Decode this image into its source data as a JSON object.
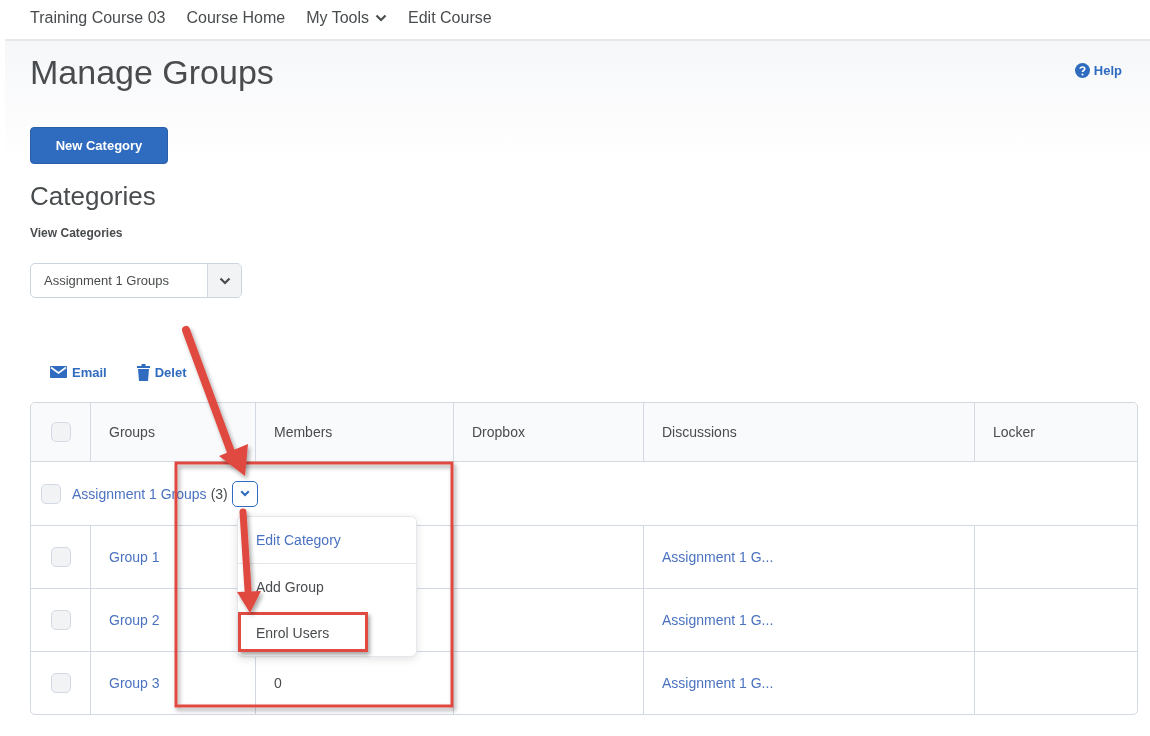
{
  "nav": {
    "items": [
      {
        "label": "Training Course 03",
        "has_menu": false
      },
      {
        "label": "Course Home",
        "has_menu": false
      },
      {
        "label": "My Tools",
        "has_menu": true
      },
      {
        "label": "Edit Course",
        "has_menu": false
      }
    ]
  },
  "page": {
    "title": "Manage Groups",
    "help": "Help"
  },
  "new_button": "New Category",
  "categories": {
    "heading": "Categories",
    "filter_label": "View Categories",
    "filter_value": "Assignment 1 Groups"
  },
  "toolbar": [
    {
      "kind": "email",
      "label": "Email"
    },
    {
      "kind": "delete",
      "label": "Delet"
    }
  ],
  "table": {
    "columns": [
      "Groups",
      "Members",
      "Dropbox",
      "Discussions",
      "Locker"
    ],
    "header_checked": false,
    "category": {
      "name": "Assignment 1 Groups",
      "count": "(3)",
      "checked": false,
      "menu_open": true
    },
    "rows": [
      {
        "name": "Group 1",
        "members": "",
        "discussion": "Assignment 1 G...",
        "checked": false
      },
      {
        "name": "Group 2",
        "members": "",
        "discussion": "Assignment 1 G...",
        "checked": false
      },
      {
        "name": "Group 3",
        "members": "0",
        "discussion": "Assignment 1 G...",
        "checked": false
      }
    ]
  },
  "menu": [
    {
      "label": "Edit Category",
      "kind": "link",
      "highlighted": false
    },
    {
      "label": "Add Group",
      "kind": "plain",
      "highlighted": false
    },
    {
      "label": "Enrol Users",
      "kind": "plain",
      "highlighted": true
    }
  ]
}
